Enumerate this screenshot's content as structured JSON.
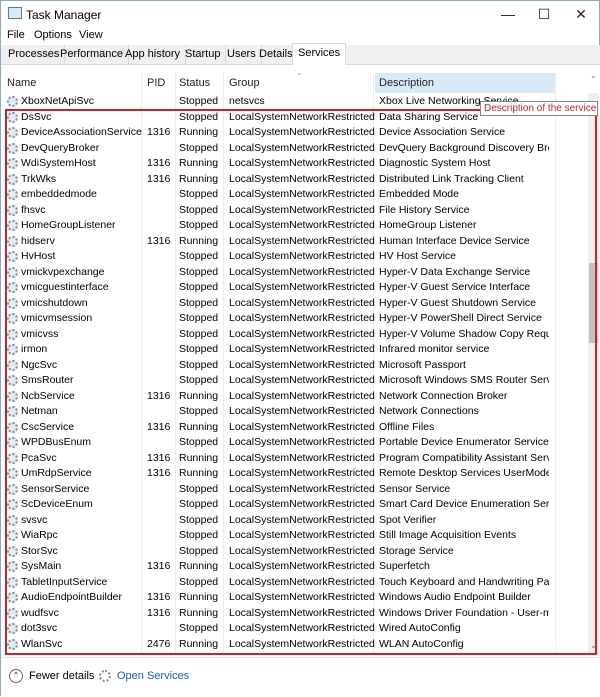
{
  "window": {
    "title": "Task Manager",
    "minimize": "—",
    "maximize": "☐",
    "close": "✕"
  },
  "menu": [
    "File",
    "Options",
    "View"
  ],
  "tabs": [
    "Processes",
    "Performance",
    "App history",
    "Startup",
    "Users",
    "Details",
    "Services"
  ],
  "active_tab": "Services",
  "columns": {
    "name": "Name",
    "pid": "PID",
    "status": "Status",
    "group": "Group",
    "description": "Description"
  },
  "tooltip": "Description of the service",
  "rows": [
    [
      "XboxNetApiSvc",
      "",
      "Stopped",
      "netsvcs",
      "Xbox Live Networking Service"
    ],
    [
      "DsSvc",
      "",
      "Stopped",
      "LocalSystemNetworkRestricted",
      "Data Sharing Service"
    ],
    [
      "DeviceAssociationService",
      "1316",
      "Running",
      "LocalSystemNetworkRestricted",
      "Device Association Service"
    ],
    [
      "DevQueryBroker",
      "",
      "Stopped",
      "LocalSystemNetworkRestricted",
      "DevQuery Background Discovery Bro..."
    ],
    [
      "WdiSystemHost",
      "1316",
      "Running",
      "LocalSystemNetworkRestricted",
      "Diagnostic System Host"
    ],
    [
      "TrkWks",
      "1316",
      "Running",
      "LocalSystemNetworkRestricted",
      "Distributed Link Tracking Client"
    ],
    [
      "embeddedmode",
      "",
      "Stopped",
      "LocalSystemNetworkRestricted",
      "Embedded Mode"
    ],
    [
      "fhsvc",
      "",
      "Stopped",
      "LocalSystemNetworkRestricted",
      "File History Service"
    ],
    [
      "HomeGroupListener",
      "",
      "Stopped",
      "LocalSystemNetworkRestricted",
      "HomeGroup Listener"
    ],
    [
      "hidserv",
      "1316",
      "Running",
      "LocalSystemNetworkRestricted",
      "Human Interface Device Service"
    ],
    [
      "HvHost",
      "",
      "Stopped",
      "LocalSystemNetworkRestricted",
      "HV Host Service"
    ],
    [
      "vmickvpexchange",
      "",
      "Stopped",
      "LocalSystemNetworkRestricted",
      "Hyper-V Data Exchange Service"
    ],
    [
      "vmicguestinterface",
      "",
      "Stopped",
      "LocalSystemNetworkRestricted",
      "Hyper-V Guest Service Interface"
    ],
    [
      "vmicshutdown",
      "",
      "Stopped",
      "LocalSystemNetworkRestricted",
      "Hyper-V Guest Shutdown Service"
    ],
    [
      "vmicvmsession",
      "",
      "Stopped",
      "LocalSystemNetworkRestricted",
      "Hyper-V PowerShell Direct Service"
    ],
    [
      "vmicvss",
      "",
      "Stopped",
      "LocalSystemNetworkRestricted",
      "Hyper-V Volume Shadow Copy Requ..."
    ],
    [
      "irmon",
      "",
      "Stopped",
      "LocalSystemNetworkRestricted",
      "Infrared monitor service"
    ],
    [
      "NgcSvc",
      "",
      "Stopped",
      "LocalSystemNetworkRestricted",
      "Microsoft Passport"
    ],
    [
      "SmsRouter",
      "",
      "Stopped",
      "LocalSystemNetworkRestricted",
      "Microsoft Windows SMS Router Servi..."
    ],
    [
      "NcbService",
      "1316",
      "Running",
      "LocalSystemNetworkRestricted",
      "Network Connection Broker"
    ],
    [
      "Netman",
      "",
      "Stopped",
      "LocalSystemNetworkRestricted",
      "Network Connections"
    ],
    [
      "CscService",
      "1316",
      "Running",
      "LocalSystemNetworkRestricted",
      "Offline Files"
    ],
    [
      "WPDBusEnum",
      "",
      "Stopped",
      "LocalSystemNetworkRestricted",
      "Portable Device Enumerator Service"
    ],
    [
      "PcaSvc",
      "1316",
      "Running",
      "LocalSystemNetworkRestricted",
      "Program Compatibility Assistant Serv..."
    ],
    [
      "UmRdpService",
      "1316",
      "Running",
      "LocalSystemNetworkRestricted",
      "Remote Desktop Services UserMode ..."
    ],
    [
      "SensorService",
      "",
      "Stopped",
      "LocalSystemNetworkRestricted",
      "Sensor Service"
    ],
    [
      "ScDeviceEnum",
      "",
      "Stopped",
      "LocalSystemNetworkRestricted",
      "Smart Card Device Enumeration Servi..."
    ],
    [
      "svsvc",
      "",
      "Stopped",
      "LocalSystemNetworkRestricted",
      "Spot Verifier"
    ],
    [
      "WiaRpc",
      "",
      "Stopped",
      "LocalSystemNetworkRestricted",
      "Still Image Acquisition Events"
    ],
    [
      "StorSvc",
      "",
      "Stopped",
      "LocalSystemNetworkRestricted",
      "Storage Service"
    ],
    [
      "SysMain",
      "1316",
      "Running",
      "LocalSystemNetworkRestricted",
      "Superfetch"
    ],
    [
      "TabletInputService",
      "",
      "Stopped",
      "LocalSystemNetworkRestricted",
      "Touch Keyboard and Handwriting Pa..."
    ],
    [
      "AudioEndpointBuilder",
      "1316",
      "Running",
      "LocalSystemNetworkRestricted",
      "Windows Audio Endpoint Builder"
    ],
    [
      "wudfsvc",
      "1316",
      "Running",
      "LocalSystemNetworkRestricted",
      "Windows Driver Foundation - User-m..."
    ],
    [
      "dot3svc",
      "",
      "Stopped",
      "LocalSystemNetworkRestricted",
      "Wired AutoConfig"
    ],
    [
      "WlanSvc",
      "2476",
      "Running",
      "LocalSystemNetworkRestricted",
      "WLAN AutoConfig"
    ]
  ],
  "footer": {
    "fewer_details": "Fewer details",
    "open_services": "Open Services"
  },
  "colors": {
    "highlight_box": "#d0202a",
    "header_selected": "#d9ebf9",
    "link": "#1a5fb4"
  }
}
